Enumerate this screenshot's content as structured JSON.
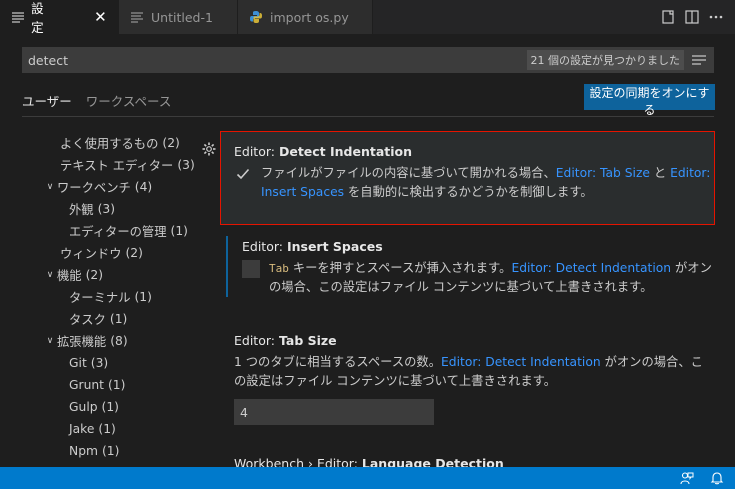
{
  "tabs": [
    {
      "label": "設定",
      "icon": "settings-list-icon",
      "close": "✕"
    },
    {
      "label": "Untitled-1",
      "icon": "file-lines-icon"
    },
    {
      "label": "import os.py",
      "icon": "python-icon"
    }
  ],
  "search": {
    "value": "detect",
    "result_count": "21 個の設定が見つかりました"
  },
  "scope_tabs": [
    "ユーザー",
    "ワークスペース"
  ],
  "sync_button": "設定の同期をオンにする",
  "toc": [
    {
      "label": "よく使用するもの",
      "count": "(2)",
      "indent": 1,
      "chevron": ""
    },
    {
      "label": "テキスト エディター",
      "count": "(3)",
      "indent": 1,
      "chevron": ""
    },
    {
      "label": "ワークベンチ",
      "count": "(4)",
      "indent": 0,
      "chevron": "∨"
    },
    {
      "label": "外観",
      "count": "(3)",
      "indent": 2,
      "chevron": ""
    },
    {
      "label": "エディターの管理",
      "count": "(1)",
      "indent": 2,
      "chevron": ""
    },
    {
      "label": "ウィンドウ",
      "count": "(2)",
      "indent": 1,
      "chevron": ""
    },
    {
      "label": "機能",
      "count": "(2)",
      "indent": 0,
      "chevron": "∨"
    },
    {
      "label": "ターミナル",
      "count": "(1)",
      "indent": 2,
      "chevron": ""
    },
    {
      "label": "タスク",
      "count": "(1)",
      "indent": 2,
      "chevron": ""
    },
    {
      "label": "拡張機能",
      "count": "(8)",
      "indent": 0,
      "chevron": "∨"
    },
    {
      "label": "Git",
      "count": "(3)",
      "indent": 2,
      "chevron": ""
    },
    {
      "label": "Grunt",
      "count": "(1)",
      "indent": 2,
      "chevron": ""
    },
    {
      "label": "Gulp",
      "count": "(1)",
      "indent": 2,
      "chevron": ""
    },
    {
      "label": "Jake",
      "count": "(1)",
      "indent": 2,
      "chevron": ""
    },
    {
      "label": "Npm",
      "count": "(1)",
      "indent": 2,
      "chevron": ""
    }
  ],
  "settings": {
    "detect_indentation": {
      "category": "Editor: ",
      "name": "Detect Indentation",
      "checked": true,
      "desc_1": "ファイルがファイルの内容に基づいて開かれる場合、",
      "link_1": "Editor: Tab Size",
      "desc_2": " と ",
      "link_2": "Editor: Insert Spaces",
      "desc_3": " を自動的に検出するかどうかを制御します。"
    },
    "insert_spaces": {
      "category": "Editor: ",
      "name": "Insert Spaces",
      "checked": false,
      "code": "Tab",
      "desc_1": " キーを押すとスペースが挿入されます。",
      "link_1": "Editor: Detect Indentation",
      "desc_2": " がオンの場合、この設定はファイル コンテンツに基づいて上書きされます。"
    },
    "tab_size": {
      "category": "Editor: ",
      "name": "Tab Size",
      "desc_1": "1 つのタブに相当するスペースの数。",
      "link_1": "Editor: Detect Indentation",
      "desc_2": " がオンの場合、この設定はファイル コンテンツに基づいて上書きされます。",
      "value": "4"
    },
    "language_detection": {
      "category": "Workbench › Editor: ",
      "name": "Language Detection"
    }
  },
  "colors": {
    "accent": "#007acc",
    "link": "#3794ff",
    "highlight_border": "#e51400",
    "button": "#0e639c"
  }
}
